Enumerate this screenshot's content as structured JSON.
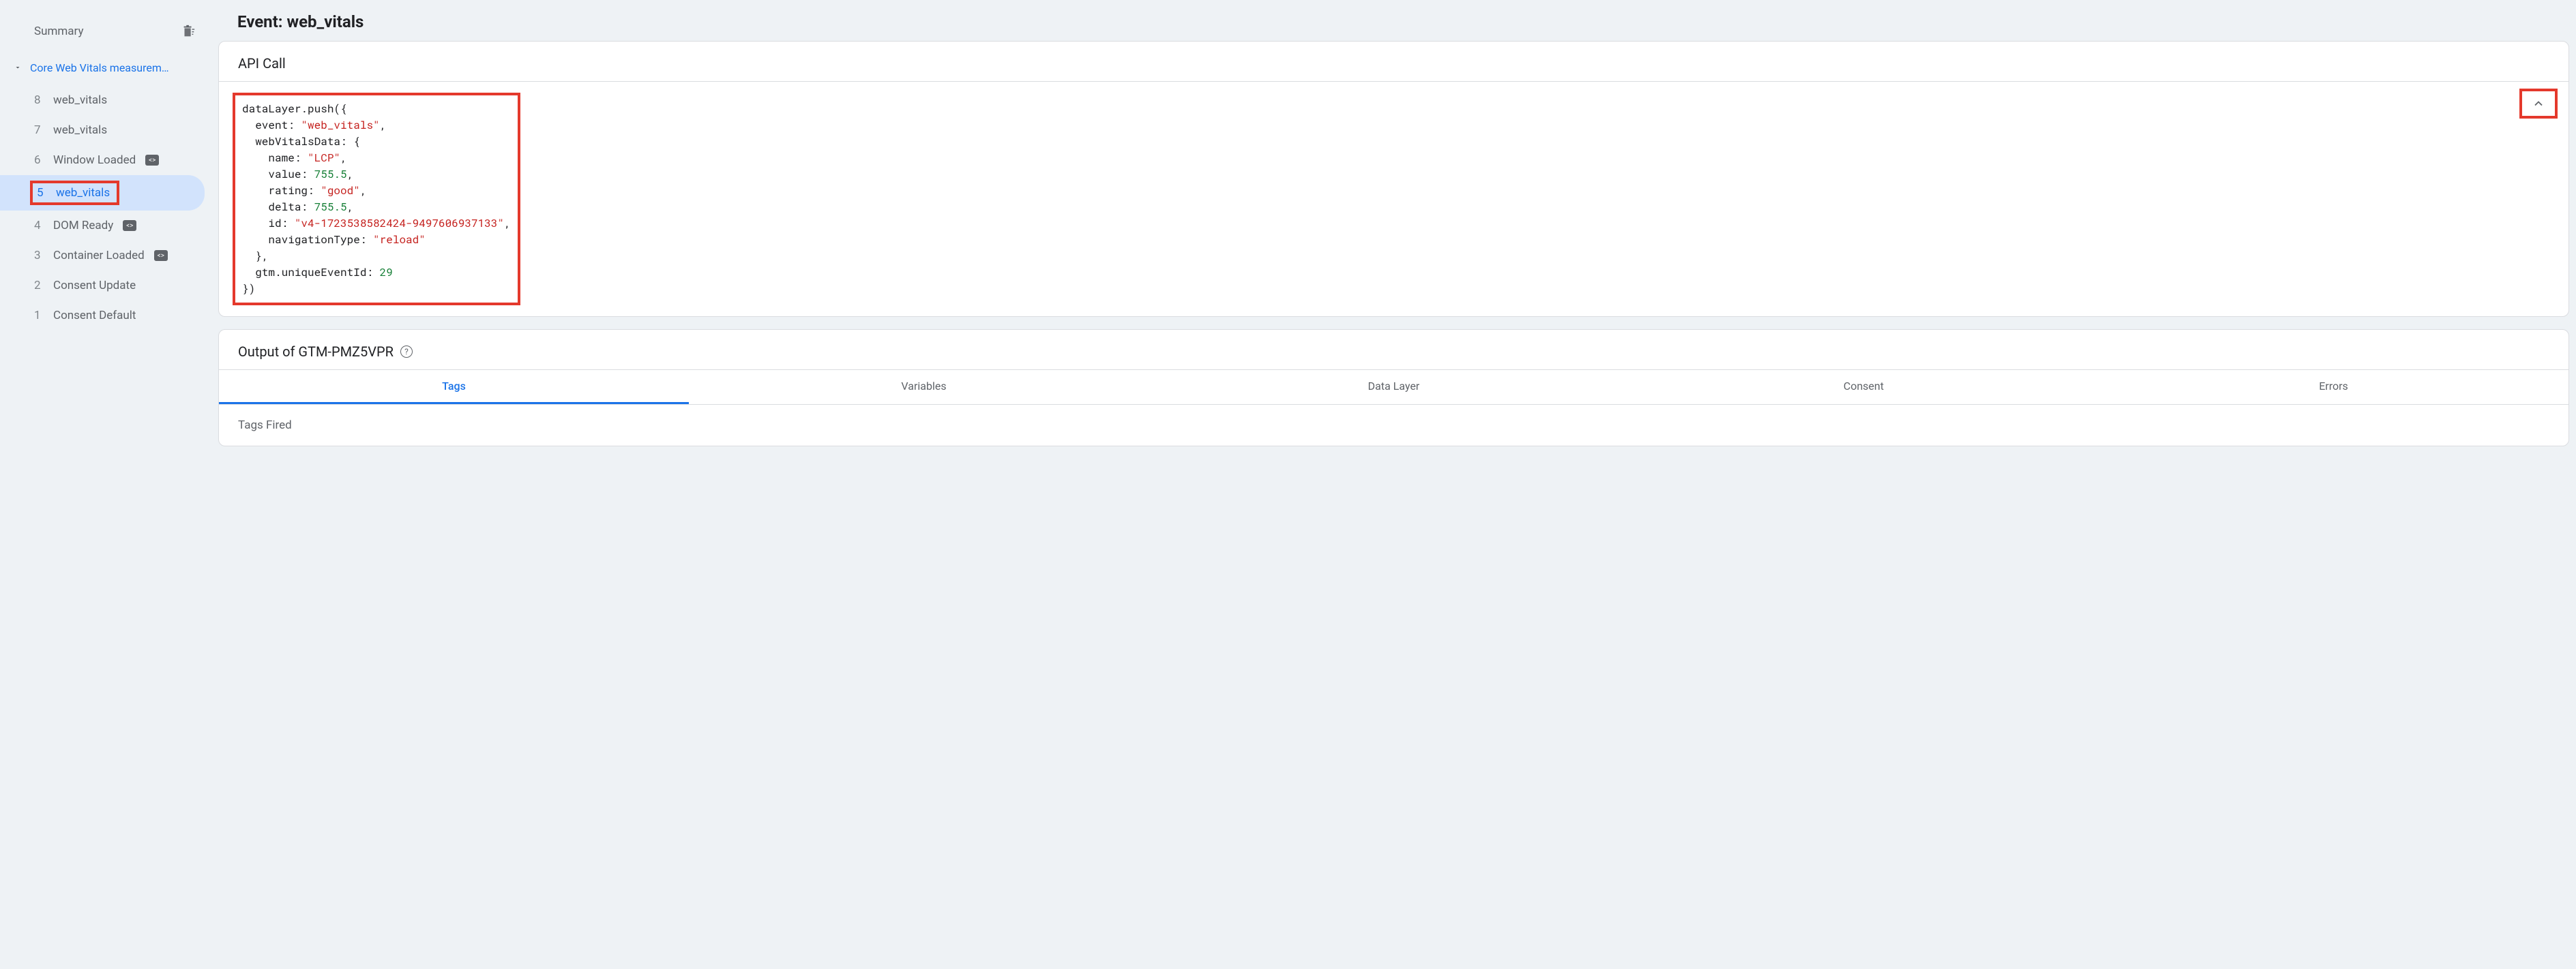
{
  "sidebar": {
    "title": "Summary",
    "group_title": "Core Web Vitals measurem…",
    "events": [
      {
        "num": "8",
        "label": "web_vitals",
        "has_badge": false
      },
      {
        "num": "7",
        "label": "web_vitals",
        "has_badge": false
      },
      {
        "num": "6",
        "label": "Window Loaded",
        "has_badge": true
      },
      {
        "num": "5",
        "label": "web_vitals",
        "has_badge": false,
        "selected": true,
        "highlight": true
      },
      {
        "num": "4",
        "label": "DOM Ready",
        "has_badge": true
      },
      {
        "num": "3",
        "label": "Container Loaded",
        "has_badge": true
      },
      {
        "num": "2",
        "label": "Consent Update",
        "has_badge": false
      },
      {
        "num": "1",
        "label": "Consent Default",
        "has_badge": false
      }
    ]
  },
  "main": {
    "event_title": "Event: web_vitals",
    "api_call": {
      "title": "API Call",
      "code": {
        "fn": "dataLayer.push",
        "event_key": "event",
        "event_val": "\"web_vitals\"",
        "wvd_key": "webVitalsData",
        "name_key": "name",
        "name_val": "\"LCP\"",
        "value_key": "value",
        "value_val": "755.5",
        "rating_key": "rating",
        "rating_val": "\"good\"",
        "delta_key": "delta",
        "delta_val": "755.5",
        "id_key": "id",
        "id_val": "\"v4-1723538582424-9497606937133\"",
        "nav_key": "navigationType",
        "nav_val": "\"reload\"",
        "gtm_key": "gtm.uniqueEventId",
        "gtm_val": "29"
      }
    },
    "output": {
      "title": "Output of GTM-PMZ5VPR",
      "tabs": [
        "Tags",
        "Variables",
        "Data Layer",
        "Consent",
        "Errors"
      ],
      "active_tab": 0,
      "tags_fired_label": "Tags Fired"
    }
  }
}
